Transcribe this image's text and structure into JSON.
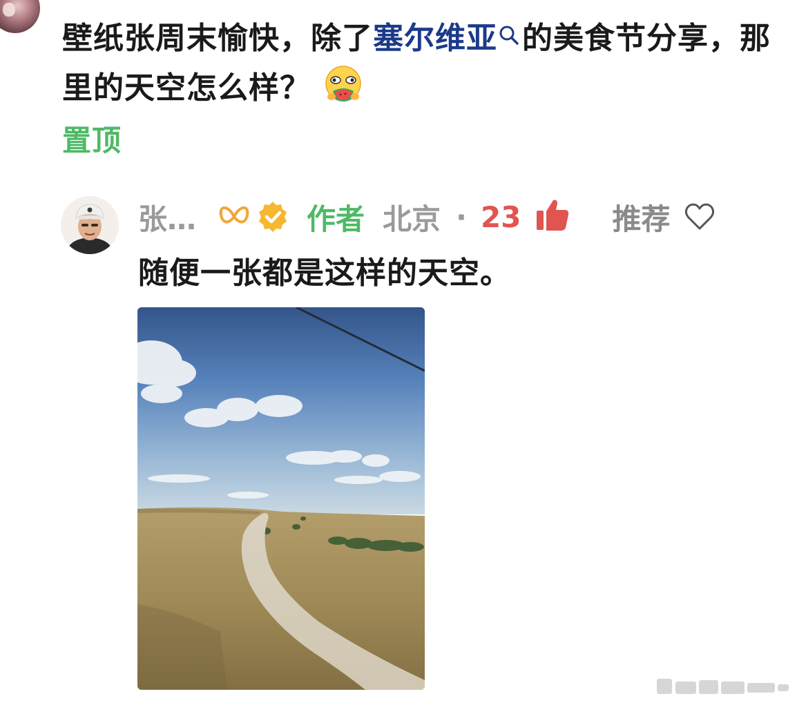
{
  "parent_comment": {
    "text_before": "壁纸张周末愉快，除了",
    "topic_link": "塞尔维亚",
    "text_after": "的美食节分享，那里的天空怎么样？",
    "emoji": "watermelon-eating-face-emoji",
    "pin_label": "置顶"
  },
  "reply": {
    "author_name": "张…",
    "author_tag": "作者",
    "location": "北京",
    "separator": "·",
    "like_count": "23",
    "recommend_label": "推荐",
    "text": "随便一张都是这样的天空。"
  },
  "colors": {
    "topic_link": "#1b3a8a",
    "pin_and_author": "#4fb965",
    "like_count": "#e05550",
    "muted": "#9a9a9a"
  },
  "icons": [
    "search-icon",
    "membership-badge-icon",
    "verified-badge-icon",
    "thumbs-up-icon",
    "heart-icon"
  ]
}
